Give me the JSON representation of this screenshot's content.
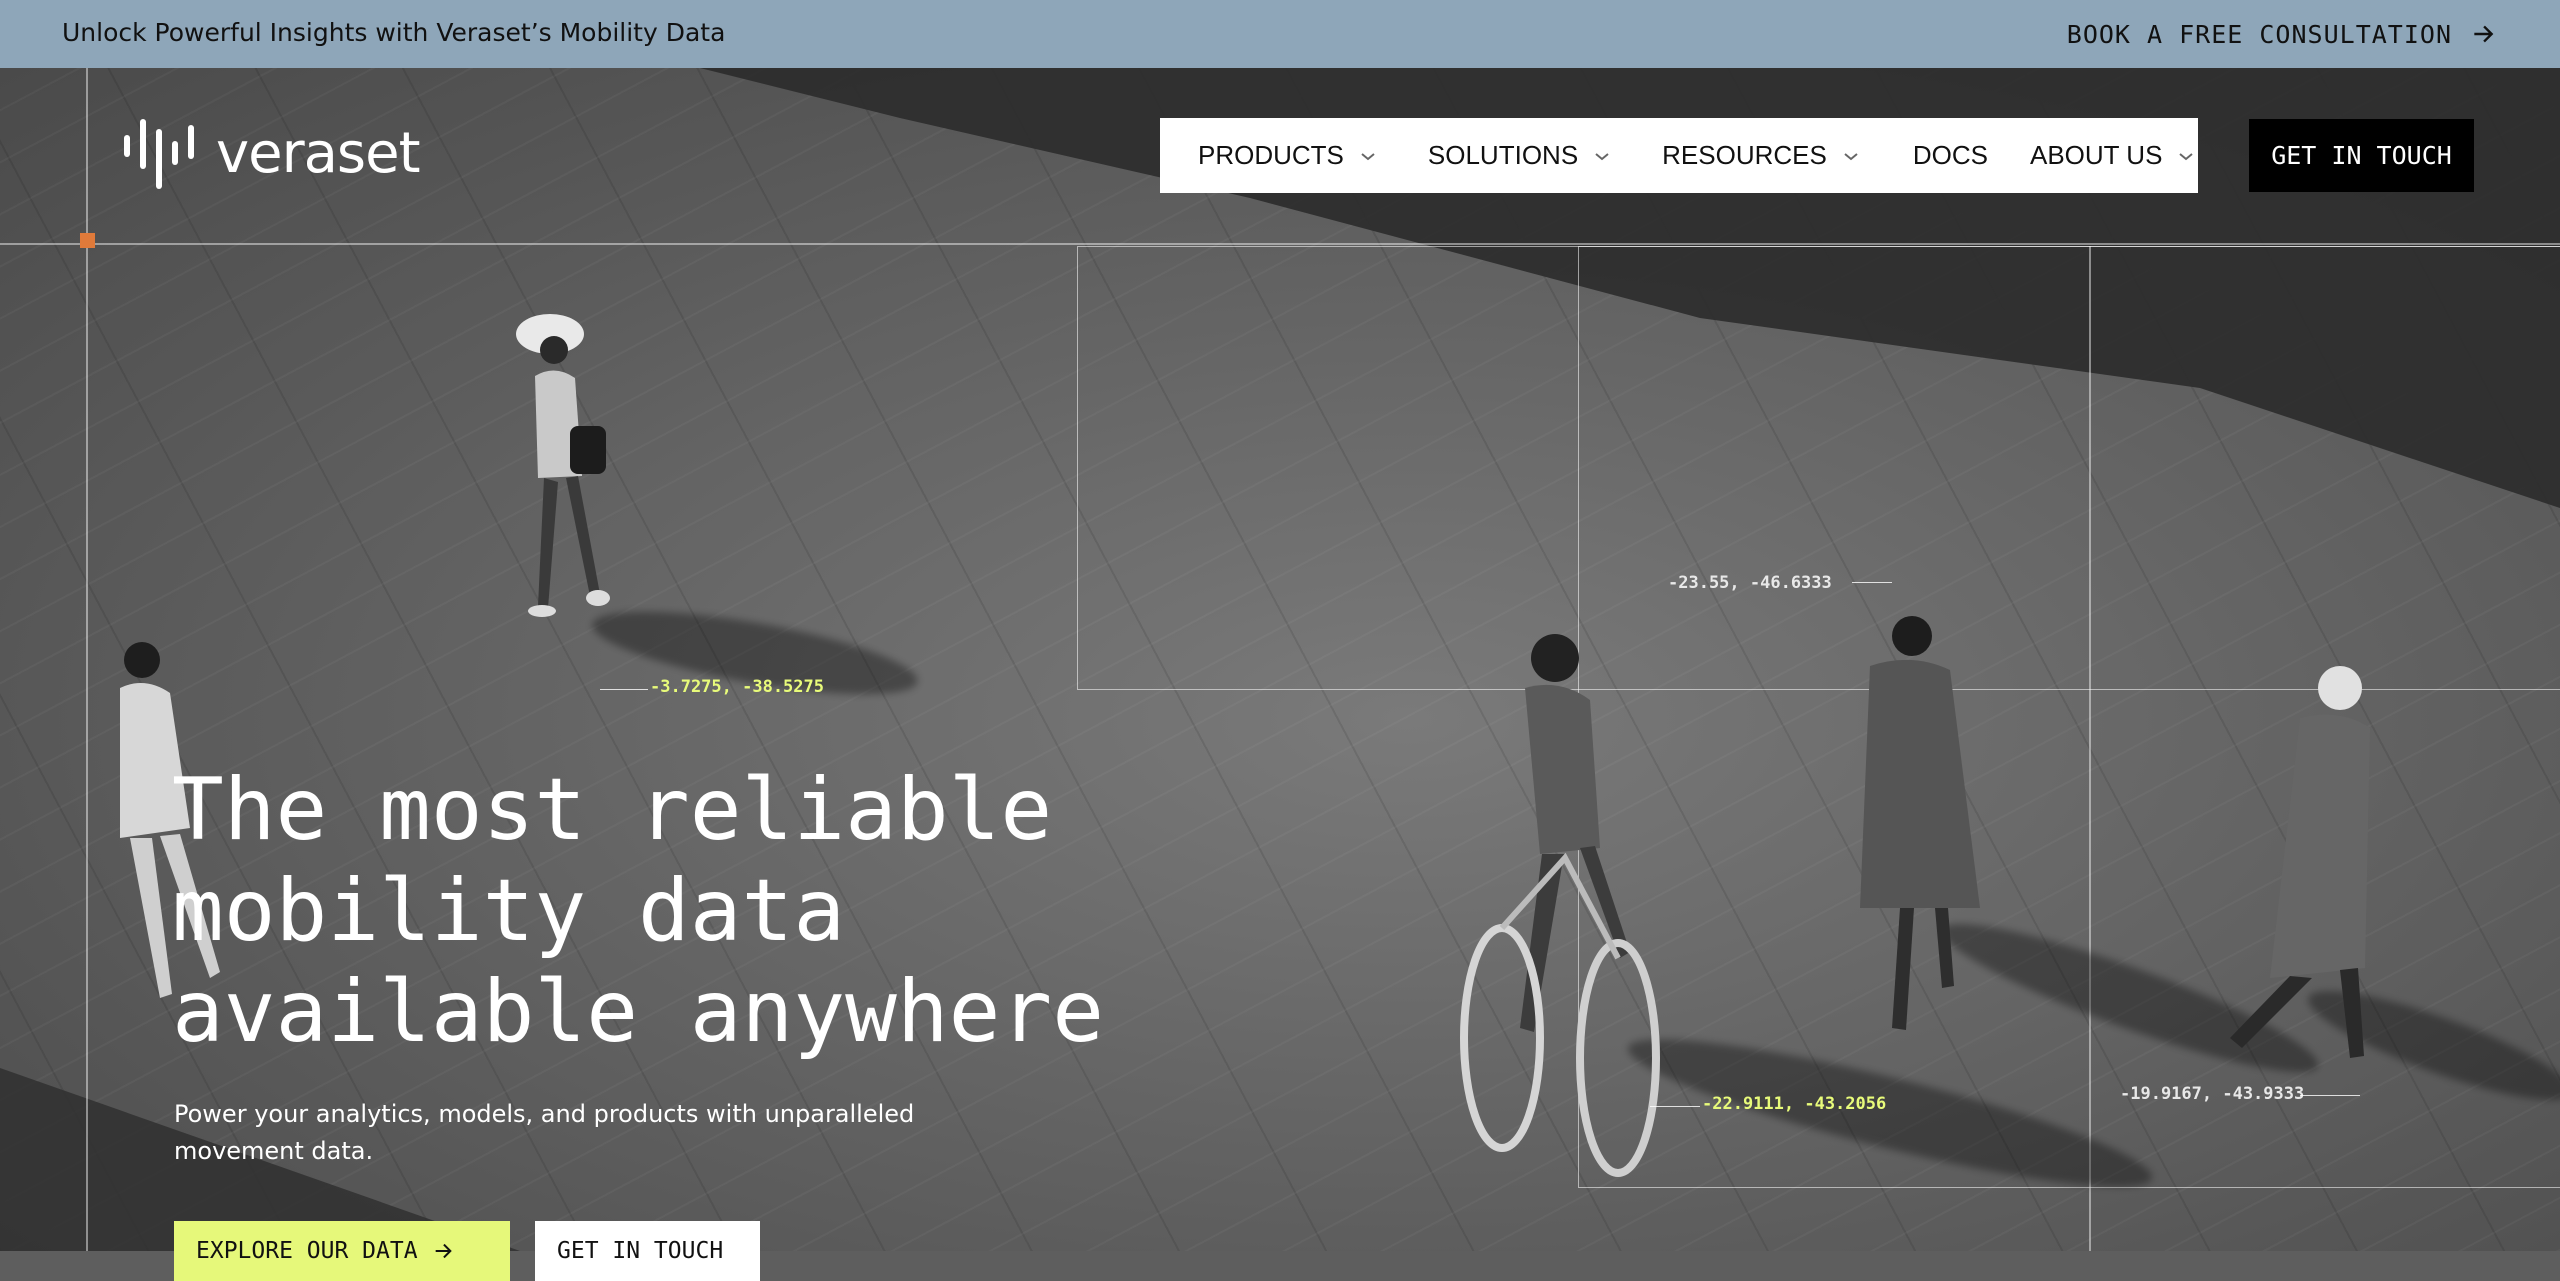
{
  "announcement": {
    "message": "Unlock Powerful Insights with Veraset’s Mobility Data",
    "cta_label": "BOOK A FREE CONSULTATION"
  },
  "header": {
    "logo_text": "veraset",
    "nav": [
      {
        "label": "PRODUCTS",
        "has_dropdown": true
      },
      {
        "label": "SOLUTIONS",
        "has_dropdown": true
      },
      {
        "label": "RESOURCES",
        "has_dropdown": true
      },
      {
        "label": "DOCS",
        "has_dropdown": false
      },
      {
        "label": "ABOUT US",
        "has_dropdown": true
      }
    ],
    "cta_label": "GET IN TOUCH"
  },
  "hero": {
    "headline_lines": [
      "The most reliable",
      "mobility data",
      "available anywhere"
    ],
    "subtext": "Power your analytics, models, and products with unparalleled movement data.",
    "primary_button": "EXPLORE OUR DATA",
    "secondary_button": "GET IN TOUCH",
    "coordinates": [
      "-3.7275, -38.5275",
      "-23.55, -46.6333",
      "-22.9111, -43.2056",
      "-19.9167, -43.9333"
    ]
  },
  "colors": {
    "announcement_bg": "#8ea6b9",
    "accent_lime": "#e6f87a",
    "marker_orange": "#e07a3a"
  }
}
